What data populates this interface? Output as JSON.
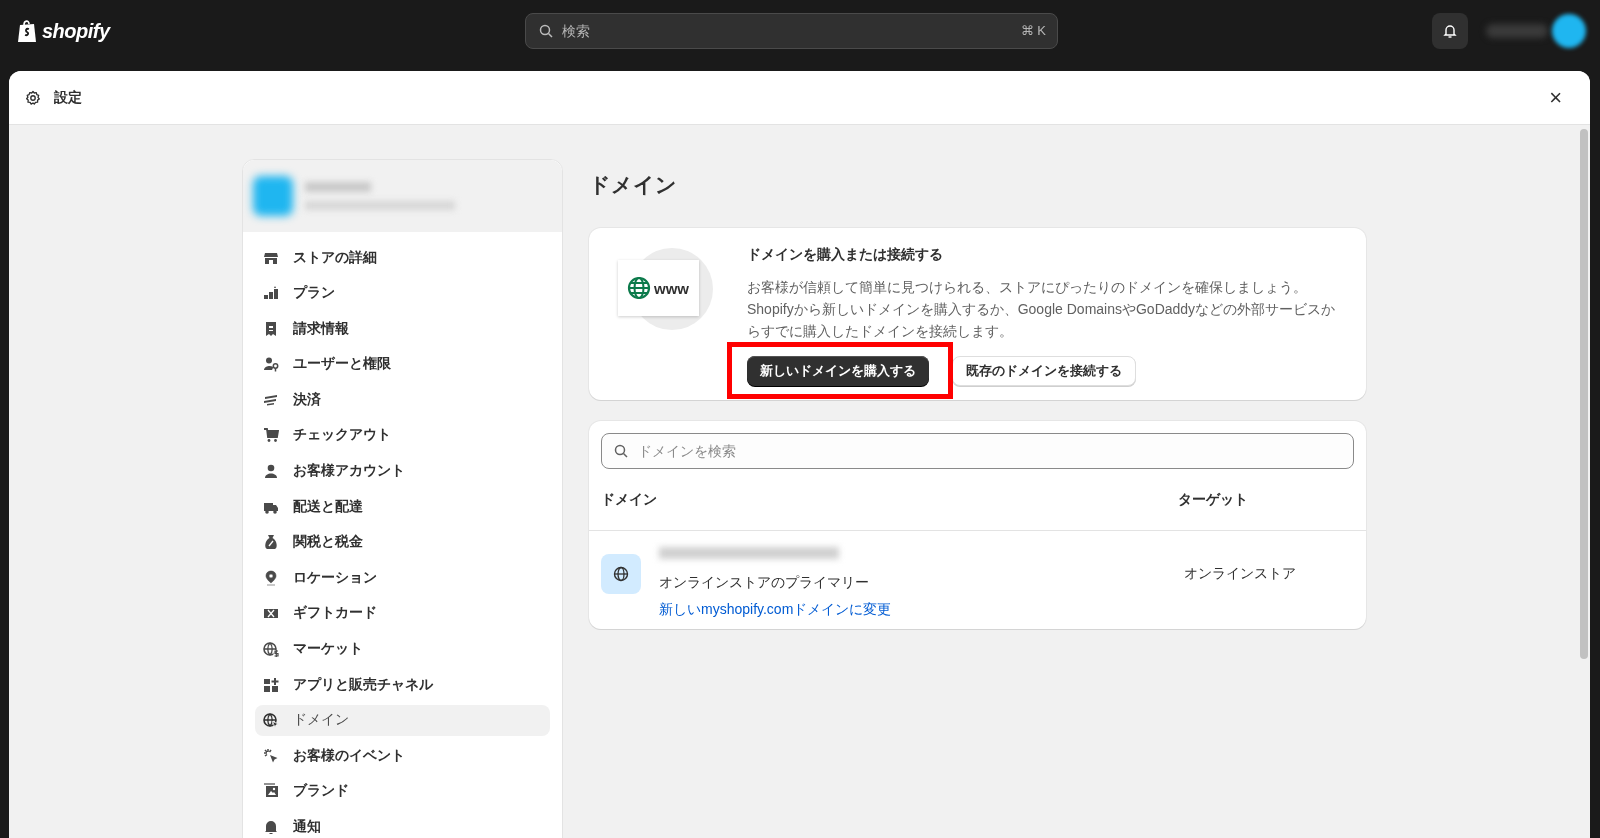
{
  "topbar": {
    "logo": "shopify",
    "search": {
      "placeholder": "検索",
      "shortcut": "⌘ K"
    }
  },
  "window": {
    "title": "設定",
    "close": "×"
  },
  "sidebar": {
    "items": [
      {
        "label": "ストアの詳細",
        "selected": false
      },
      {
        "label": "プラン",
        "selected": false
      },
      {
        "label": "請求情報",
        "selected": false
      },
      {
        "label": "ユーザーと権限",
        "selected": false
      },
      {
        "label": "決済",
        "selected": false
      },
      {
        "label": "チェックアウト",
        "selected": false
      },
      {
        "label": "お客様アカウント",
        "selected": false
      },
      {
        "label": "配送と配達",
        "selected": false
      },
      {
        "label": "関税と税金",
        "selected": false
      },
      {
        "label": "ロケーション",
        "selected": false
      },
      {
        "label": "ギフトカード",
        "selected": false
      },
      {
        "label": "マーケット",
        "selected": false
      },
      {
        "label": "アプリと販売チャネル",
        "selected": false
      },
      {
        "label": "ドメイン",
        "selected": true
      },
      {
        "label": "お客様のイベント",
        "selected": false
      },
      {
        "label": "ブランド",
        "selected": false
      },
      {
        "label": "通知",
        "selected": false
      }
    ]
  },
  "page": {
    "title": "ドメイン",
    "promo": {
      "badge": "www",
      "heading": "ドメインを購入または接続する",
      "body": "お客様が信頼して簡単に見つけられる、ストアにぴったりのドメインを確保しましょう。Shopifyから新しいドメインを購入するか、Google DomainsやGoDaddyなどの外部サービスからすでに購入したドメインを接続します。",
      "buttons": [
        {
          "label": "新しいドメインを購入する",
          "kind": "primary",
          "highlighted": true
        },
        {
          "label": "既存のドメインを接続する",
          "kind": "secondary",
          "highlighted": false
        }
      ]
    },
    "domains": {
      "search": {
        "placeholder": "ドメインを検索"
      },
      "columns": [
        "ドメイン",
        "ターゲット"
      ],
      "rows": [
        {
          "description": "オンラインストアのプライマリー",
          "link": "新しいmyshopify.comドメインに変更",
          "target": "オンラインストア"
        }
      ]
    }
  }
}
